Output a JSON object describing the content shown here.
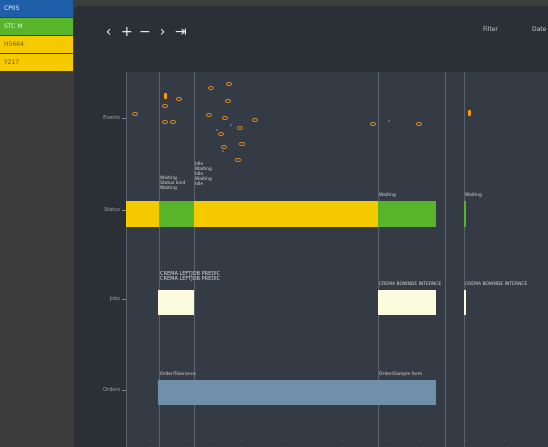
{
  "legend": [
    {
      "label": "CP05",
      "color": "#1f5ea8"
    },
    {
      "label": "STC M",
      "color": "#58b428"
    },
    {
      "label": "H5664",
      "color": "#f5cb00"
    },
    {
      "label": "Y217",
      "color": "#f5cb00"
    }
  ],
  "toolbar": {
    "back_icon": "‹",
    "zoom_in_icon": "+",
    "zoom_out_icon": "−",
    "forward_icon": "›",
    "skip_end_icon": "⇥"
  },
  "menu": {
    "filter": "Filter",
    "date": "Date"
  },
  "rows": [
    {
      "label": "Events"
    },
    {
      "label": "Status"
    },
    {
      "label": "Jobs"
    },
    {
      "label": "Orders"
    }
  ],
  "status_notes": [
    "Waiting\nStatus kind\nWaiting",
    "Idle\nWaiting\nIdle\nWaiting\nIdle",
    "Waiting",
    "Waiting"
  ],
  "job_labels": [
    "CREMA LEFTJOB PREDIC\nCREMA LEFTJOB PREDIC",
    "CREMA BOWNDE INTERNCE",
    "CREMA BOWNDE INTERNCE"
  ],
  "order_labels": [
    "Order/Tolerance",
    "Order/Sample form"
  ],
  "colors": {
    "status_yellow": "#f5cb00",
    "status_green": "#58b428",
    "job_fill": "#fdfbdd",
    "order_fill": "#6f8fab",
    "event_orange": "#e08a1e",
    "event_blue": "#4a78c4"
  }
}
